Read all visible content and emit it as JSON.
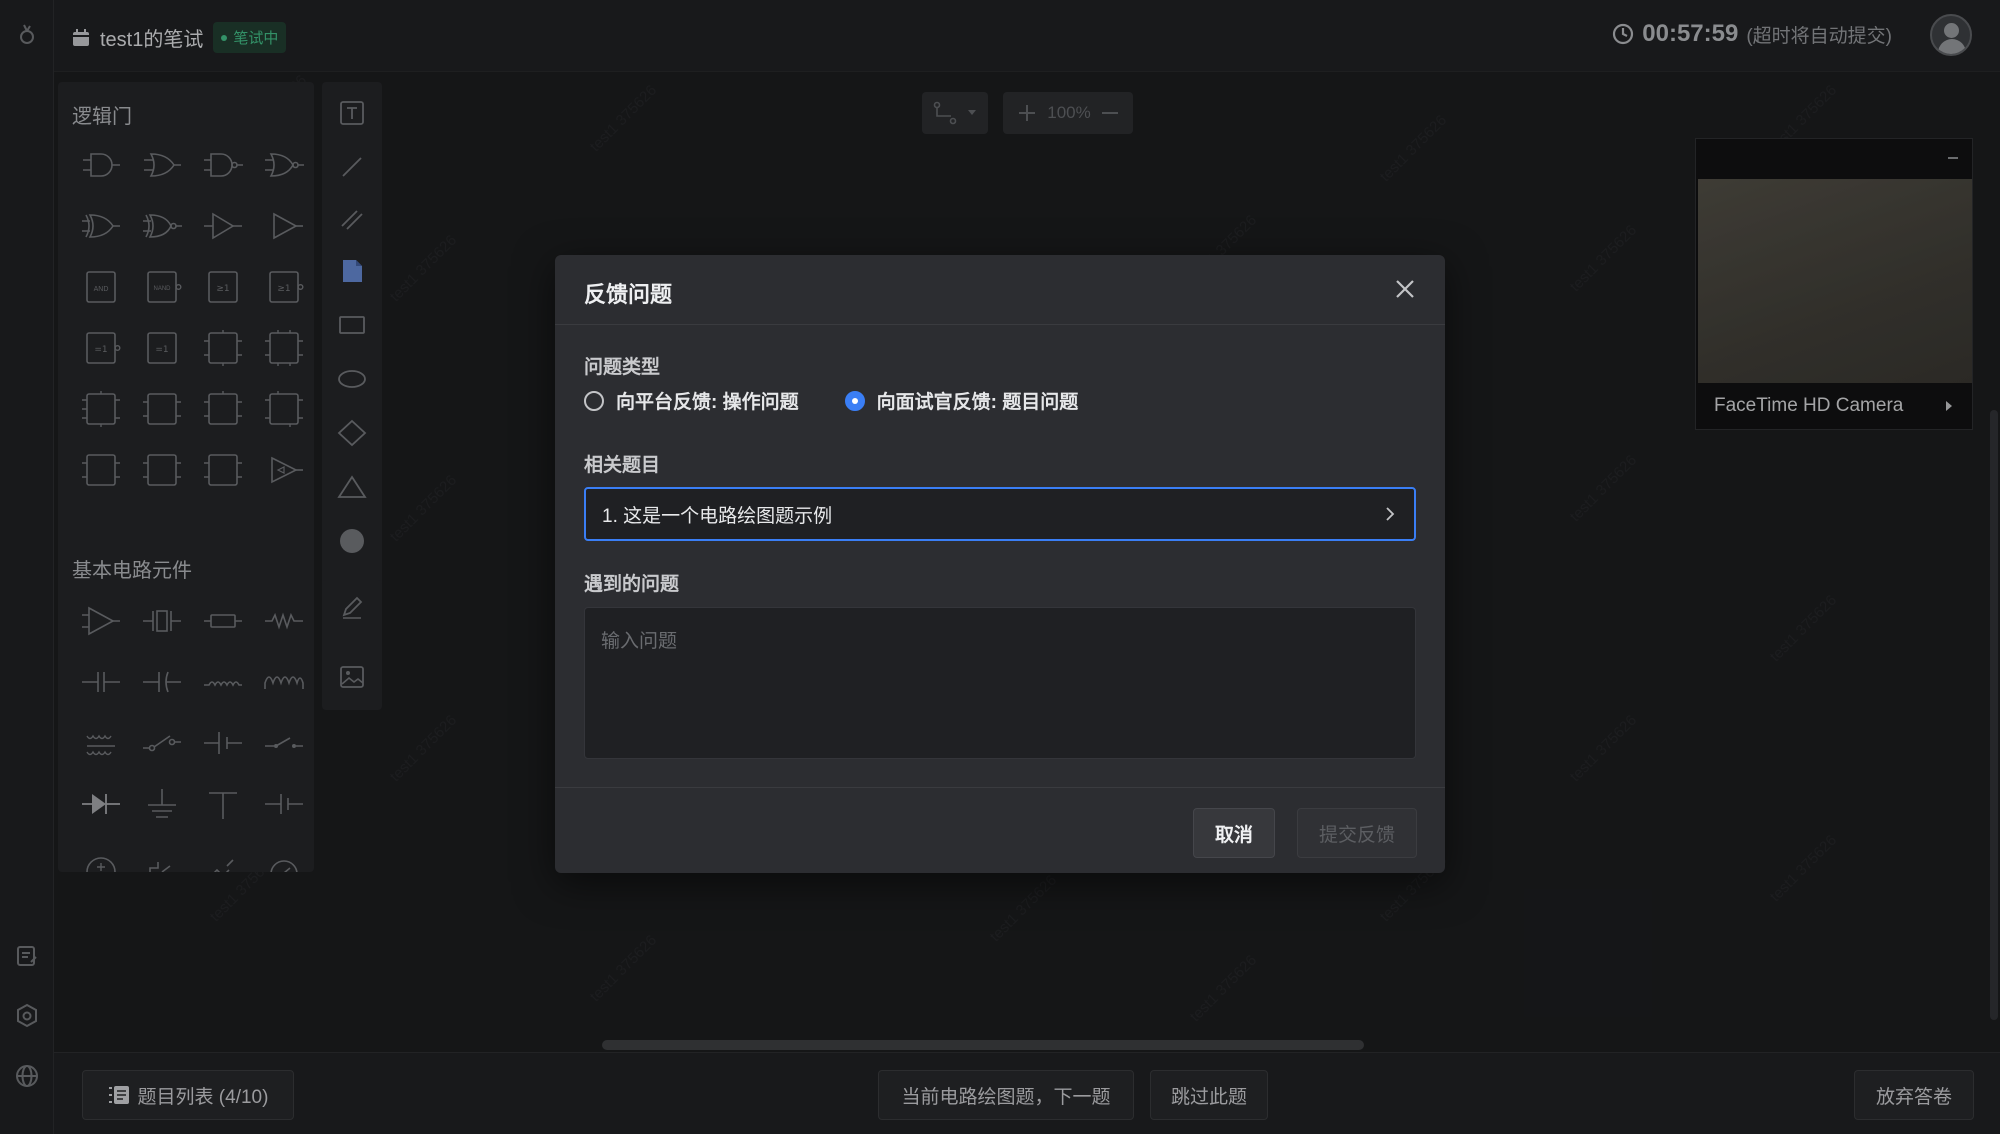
{
  "header": {
    "exam_title": "test1的笔试",
    "status": "笔试中",
    "timer": "00:57:59",
    "timer_note": "(超时将自动提交)"
  },
  "panel": {
    "logic_gates_title": "逻辑门",
    "basic_components_title": "基本电路元件",
    "logic_labels": [
      "AND",
      "NAND",
      "≥1",
      "≥1",
      "=1",
      "=1"
    ]
  },
  "canvas": {
    "zoom": "100%"
  },
  "camera": {
    "label": "FaceTime HD Camera"
  },
  "bottom": {
    "question_list": "题目列表 (4/10)",
    "next_button": "当前电路绘图题，下一题",
    "skip_button": "跳过此题",
    "abandon_button": "放弃答卷"
  },
  "modal": {
    "title": "反馈问题",
    "type_label": "问题类型",
    "options": [
      {
        "label": "向平台反馈: 操作问题",
        "selected": false
      },
      {
        "label": "向面试官反馈: 题目问题",
        "selected": true
      }
    ],
    "related_label": "相关题目",
    "related_value": "1. 这是一个电路绘图题示例",
    "problem_label": "遇到的问题",
    "problem_placeholder": "输入问题",
    "cancel_button": "取消",
    "submit_button": "提交反馈"
  },
  "watermark": "test1 375626",
  "colors": {
    "accent": "#3a7ef5",
    "status_green": "#3fb27f",
    "background": "#1a1b1d",
    "modal": "#2c2d31"
  }
}
